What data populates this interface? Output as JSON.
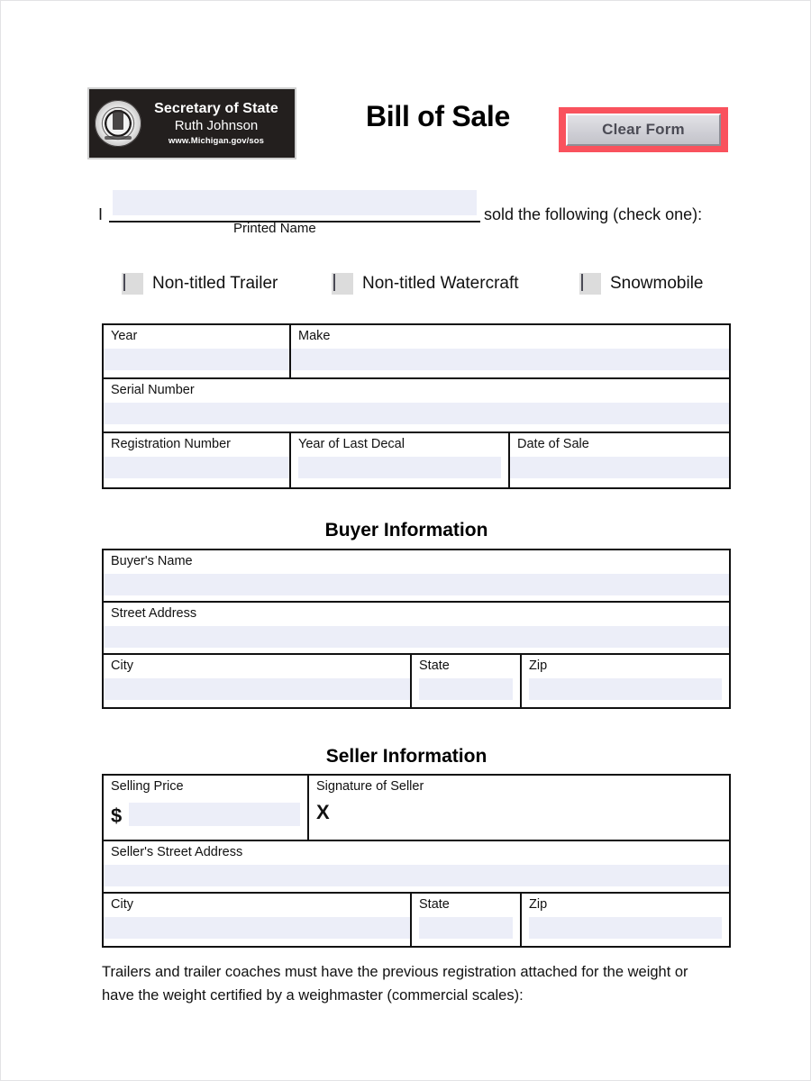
{
  "header": {
    "logo": {
      "seal_icon": "michigan-state-seal-icon",
      "line1": "Secretary of State",
      "line2": "Ruth Johnson",
      "line3": "www.Michigan.gov/sos"
    },
    "title": "Bill of Sale",
    "clear_form_label": "Clear Form",
    "clear_form_highlight_color": "#f9525d",
    "clear_form_face_color": "#d2d2d8"
  },
  "intro": {
    "lead": "I",
    "name_value": "",
    "name_placeholder": "",
    "name_caption": "Printed Name",
    "trailing": "sold the following (check one):"
  },
  "item_type": {
    "options": [
      {
        "label": "Non-titled Trailer",
        "checked": false
      },
      {
        "label": "Non-titled Watercraft",
        "checked": false
      },
      {
        "label": "Snowmobile",
        "checked": false
      }
    ]
  },
  "vehicle_table": {
    "rows": [
      [
        {
          "label": "Year",
          "value": "",
          "field": "full"
        },
        {
          "label": "Make",
          "value": "",
          "field": "full"
        }
      ],
      [
        {
          "label": "Serial Number",
          "value": "",
          "field": "full"
        }
      ],
      [
        {
          "label": "Registration Number",
          "value": "",
          "field": "full"
        },
        {
          "label": "Year of Last Decal",
          "value": "",
          "field": "inset"
        },
        {
          "label": "Date of Sale",
          "value": "",
          "field": "full"
        }
      ]
    ]
  },
  "buyer": {
    "heading": "Buyer Information",
    "rows": [
      [
        {
          "label": "Buyer's Name",
          "value": "",
          "field": "full"
        }
      ],
      [
        {
          "label": "Street Address",
          "value": "",
          "field": "full"
        }
      ],
      [
        {
          "label": "City",
          "value": "",
          "field": "full"
        },
        {
          "label": "State",
          "value": "",
          "field": "inset"
        },
        {
          "label": "Zip",
          "value": "",
          "field": "inset"
        }
      ]
    ]
  },
  "seller": {
    "heading": "Seller Information",
    "price_label": "Selling Price",
    "currency_symbol": "$",
    "price_value": "",
    "signature_label": "Signature of Seller",
    "signature_mark": "X",
    "rows": [
      [
        {
          "label": "Seller's Street Address",
          "value": "",
          "field": "full"
        }
      ],
      [
        {
          "label": "City",
          "value": "",
          "field": "full"
        },
        {
          "label": "State",
          "value": "",
          "field": "inset"
        },
        {
          "label": "Zip",
          "value": "",
          "field": "inset"
        }
      ]
    ]
  },
  "footer": {
    "note": "Trailers and trailer coaches must have the previous registration attached for the weight or have the weight certified by a weighmaster (commercial scales):"
  }
}
